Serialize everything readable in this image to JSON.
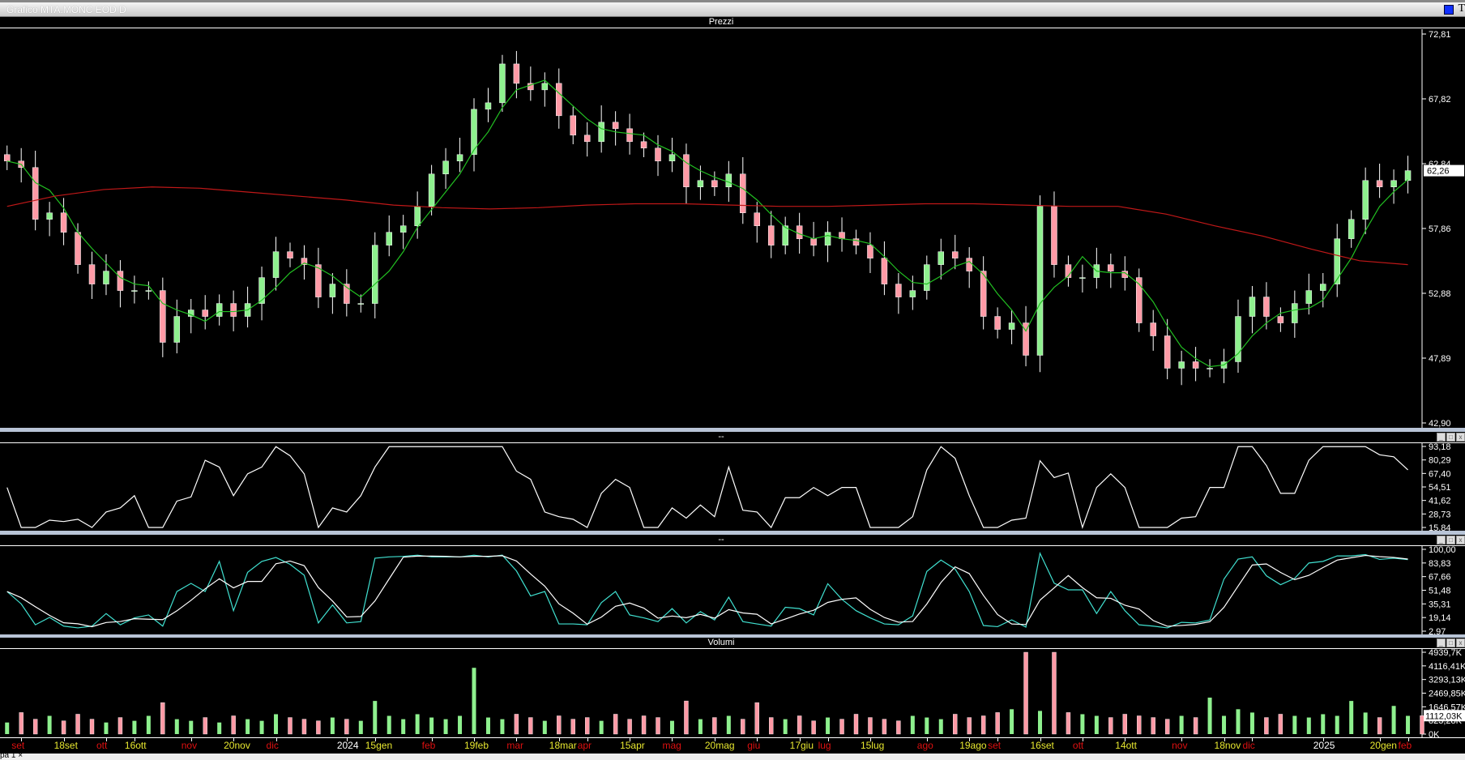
{
  "window": {
    "title": "Grafico MTA.MONC EOD D",
    "corner_letter": "T"
  },
  "panels": {
    "price": "Prezzi",
    "rsi": "--",
    "stoch": "--",
    "volume": "Volumi"
  },
  "bottom_tab": "pa 1 ×",
  "colors": {
    "up": "#8ef08e",
    "down": "#ff9aa6",
    "ma_short": "#22c022",
    "ma_long": "#c01818",
    "stoch_k": "#40e0d0",
    "line": "#ffffff",
    "month": "#dd1010",
    "day": "#e8e830",
    "year": "#ffffff"
  },
  "chart_data": {
    "type": "candlestick",
    "closes": [
      63,
      62.5,
      58.5,
      59,
      57.5,
      55,
      53.5,
      54.5,
      53,
      53,
      53,
      49,
      51,
      51.5,
      51,
      52,
      51,
      52,
      54,
      56,
      55.5,
      55,
      52.5,
      53.5,
      52,
      52,
      56.5,
      57.5,
      58,
      59.5,
      62,
      63,
      63.5,
      67,
      67.5,
      70.5,
      69,
      68.5,
      69,
      66.5,
      65,
      64.5,
      66,
      65.5,
      64.5,
      64,
      63,
      63.5,
      61,
      61.5,
      61,
      62,
      59,
      58,
      56.5,
      58,
      57,
      56.5,
      57.5,
      57,
      56.5,
      55.5,
      53.5,
      52.5,
      53,
      55,
      56,
      55.5,
      54.5,
      51,
      50,
      50.5,
      48,
      59.5,
      55,
      54,
      54,
      55,
      54.5,
      54,
      50.5,
      49.5,
      47,
      47.5,
      47,
      47,
      47.5,
      51,
      52.5,
      51,
      50.5,
      52,
      53,
      53.5,
      57,
      58.5,
      61.5,
      61,
      61.5,
      62.26
    ],
    "ma_long": [
      59.5,
      60.3,
      60.8,
      61,
      60.9,
      60.6,
      60.3,
      60,
      59.6,
      59.4,
      59.3,
      59.4,
      59.6,
      59.7,
      59.7,
      59.6,
      59.5,
      59.5,
      59.6,
      59.7,
      59.7,
      59.6,
      59.5,
      59.5,
      58.9,
      58,
      57.2,
      56.2,
      55.3,
      55
    ],
    "volumes_k": [
      700,
      1300,
      900,
      1100,
      800,
      1200,
      900,
      700,
      1000,
      800,
      1100,
      1900,
      900,
      800,
      1000,
      700,
      1100,
      900,
      800,
      1200,
      1000,
      900,
      800,
      1000,
      900,
      800,
      2000,
      1100,
      900,
      1200,
      1000,
      900,
      1100,
      4000,
      1000,
      900,
      1200,
      1000,
      800,
      1100,
      900,
      1000,
      800,
      1200,
      900,
      1100,
      1000,
      800,
      2000,
      900,
      1000,
      1100,
      900,
      1900,
      1000,
      900,
      1100,
      800,
      1000,
      900,
      1200,
      1000,
      900,
      800,
      1100,
      1000,
      900,
      1200,
      1000,
      1100,
      1300,
      1500,
      4939,
      1400,
      4939,
      1300,
      1200,
      1100,
      1000,
      1200,
      1100,
      1000,
      900,
      1100,
      1000,
      2200,
      1100,
      1500,
      1300,
      1000,
      1200,
      1100,
      1000,
      1200,
      1100,
      2000,
      1300,
      1000,
      1700,
      1100,
      1112
    ],
    "price_axis": [
      "72,81",
      "67,82",
      "62,84",
      "57,86",
      "52,88",
      "47,89",
      "42,90"
    ],
    "price_range": [
      42.9,
      72.81
    ],
    "last_price": "62,26",
    "rsi_axis": [
      "93,18",
      "80,29",
      "67,40",
      "54,51",
      "41,62",
      "28,73",
      "15,84"
    ],
    "rsi_range": [
      15.84,
      93.18
    ],
    "stoch_axis": [
      "100,00",
      "83,83",
      "67,66",
      "51,48",
      "35,31",
      "19,14",
      "2,97"
    ],
    "stoch_range": [
      2.97,
      100
    ],
    "volume_axis": [
      "4939,7K",
      "4116,41K",
      "3293,13K",
      "2469,85K",
      "1646,57K",
      "823,28K",
      "0K"
    ],
    "volume_max": 4939.7,
    "last_volume": "1112,03K",
    "x_labels": [
      [
        "set",
        "month",
        1
      ],
      [
        "18set",
        "day",
        4
      ],
      [
        "ott",
        "month",
        7
      ],
      [
        "16ott",
        "day",
        9
      ],
      [
        "nov",
        "month",
        13
      ],
      [
        "20nov",
        "day",
        16
      ],
      [
        "dic",
        "month",
        19
      ],
      [
        "2024",
        "year",
        24
      ],
      [
        "15gen",
        "day",
        26
      ],
      [
        "feb",
        "month",
        30
      ],
      [
        "19feb",
        "day",
        33
      ],
      [
        "mar",
        "month",
        36
      ],
      [
        "18mar",
        "day",
        39
      ],
      [
        "apr",
        "month",
        41
      ],
      [
        "15apr",
        "day",
        44
      ],
      [
        "mag",
        "month",
        47
      ],
      [
        "20mag",
        "day",
        50
      ],
      [
        "giu",
        "month",
        53
      ],
      [
        "17giu",
        "day",
        56
      ],
      [
        "lug",
        "month",
        58
      ],
      [
        "15lug",
        "day",
        61
      ],
      [
        "ago",
        "month",
        65
      ],
      [
        "19ago",
        "day",
        68
      ],
      [
        "set",
        "month",
        70
      ],
      [
        "16set",
        "day",
        73
      ],
      [
        "ott",
        "month",
        76
      ],
      [
        "14ott",
        "day",
        79
      ],
      [
        "nov",
        "month",
        83
      ],
      [
        "18nov",
        "day",
        86
      ],
      [
        "dic",
        "month",
        88
      ],
      [
        "2025",
        "year",
        93
      ],
      [
        "20gen",
        "day",
        97
      ],
      [
        "feb",
        "month",
        99
      ]
    ]
  }
}
